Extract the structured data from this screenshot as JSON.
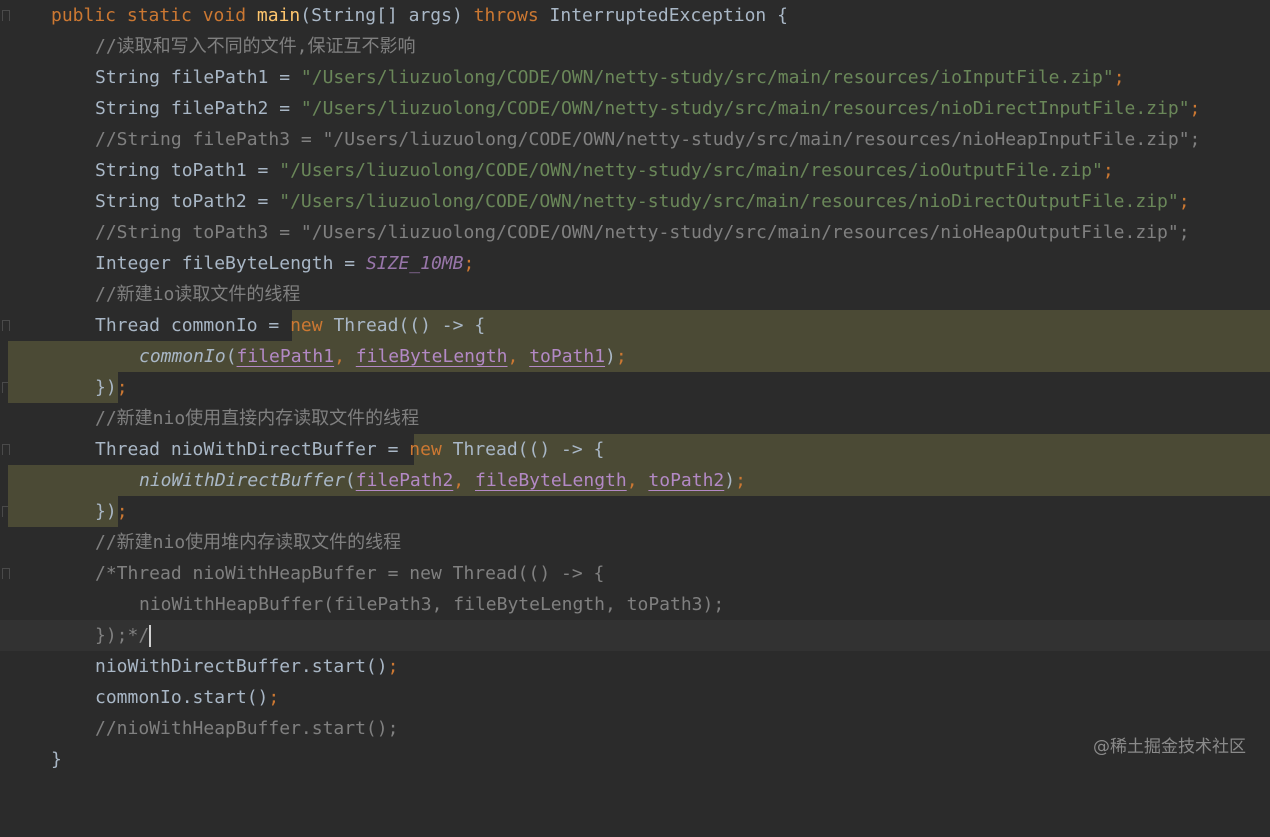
{
  "lines": {
    "l1": {
      "kw1": "public static void ",
      "fn": "main",
      "rest": "(String[] args) ",
      "kw2": "throws ",
      "rest2": "InterruptedException {"
    },
    "l2": "//读取和写入不同的文件,保证互不影响",
    "l3": {
      "a": "String filePath1 = ",
      "s": "\"/Users/liuzuolong/CODE/OWN/netty-study/src/main/resources/ioInputFile.zip\"",
      "e": ";"
    },
    "l4": {
      "a": "String filePath2 = ",
      "s": "\"/Users/liuzuolong/CODE/OWN/netty-study/src/main/resources/nioDirectInputFile.zip\"",
      "e": ";"
    },
    "l5": "//String filePath3 = \"/Users/liuzuolong/CODE/OWN/netty-study/src/main/resources/nioHeapInputFile.zip\";",
    "l6": {
      "a": "String toPath1 = ",
      "s": "\"/Users/liuzuolong/CODE/OWN/netty-study/src/main/resources/ioOutputFile.zip\"",
      "e": ";"
    },
    "l7": {
      "a": "String toPath2 = ",
      "s": "\"/Users/liuzuolong/CODE/OWN/netty-study/src/main/resources/nioDirectOutputFile.zip\"",
      "e": ";"
    },
    "l8": "//String toPath3 = \"/Users/liuzuolong/CODE/OWN/netty-study/src/main/resources/nioHeapOutputFile.zip\";",
    "l9": {
      "a": "Integer fileByteLength = ",
      "c": "SIZE_10MB",
      "e": ";"
    },
    "l10": "//新建io读取文件的线程",
    "l11": {
      "a": "Thread commonIo = ",
      "kw": "new ",
      "b": "Thread(() -> {"
    },
    "l12": {
      "fn": "commonIo",
      "p1": "filePath1",
      "p2": "fileByteLength",
      "p3": "toPath1"
    },
    "l13": {
      "a": "})",
      "e": ";"
    },
    "l14": "//新建nio使用直接内存读取文件的线程",
    "l15": {
      "a": "Thread nioWithDirectBuffer = ",
      "kw": "new ",
      "b": "Thread(() -> {"
    },
    "l16": {
      "fn": "nioWithDirectBuffer",
      "p1": "filePath2",
      "p2": "fileByteLength",
      "p3": "toPath2"
    },
    "l17": {
      "a": "})",
      "e": ";"
    },
    "l18": "//新建nio使用堆内存读取文件的线程",
    "l19": "/*Thread nioWithHeapBuffer = new Thread(() -> {",
    "l20": "nioWithHeapBuffer(filePath3, fileByteLength, toPath3);",
    "l21": "});*/",
    "l22": {
      "a": "nioWithDirectBuffer.start()",
      "e": ";"
    },
    "l23": {
      "a": "commonIo.start()",
      "e": ";"
    },
    "l24": "//nioWithHeapBuffer.start();",
    "l25": "}"
  },
  "watermark": "@稀土掘金技术社区",
  "colors": {
    "keyword": "#cc7832",
    "string": "#6a8759",
    "comment": "#808080",
    "function": "#ffc66d",
    "constant": "#9876aa",
    "background": "#2b2b2b"
  }
}
